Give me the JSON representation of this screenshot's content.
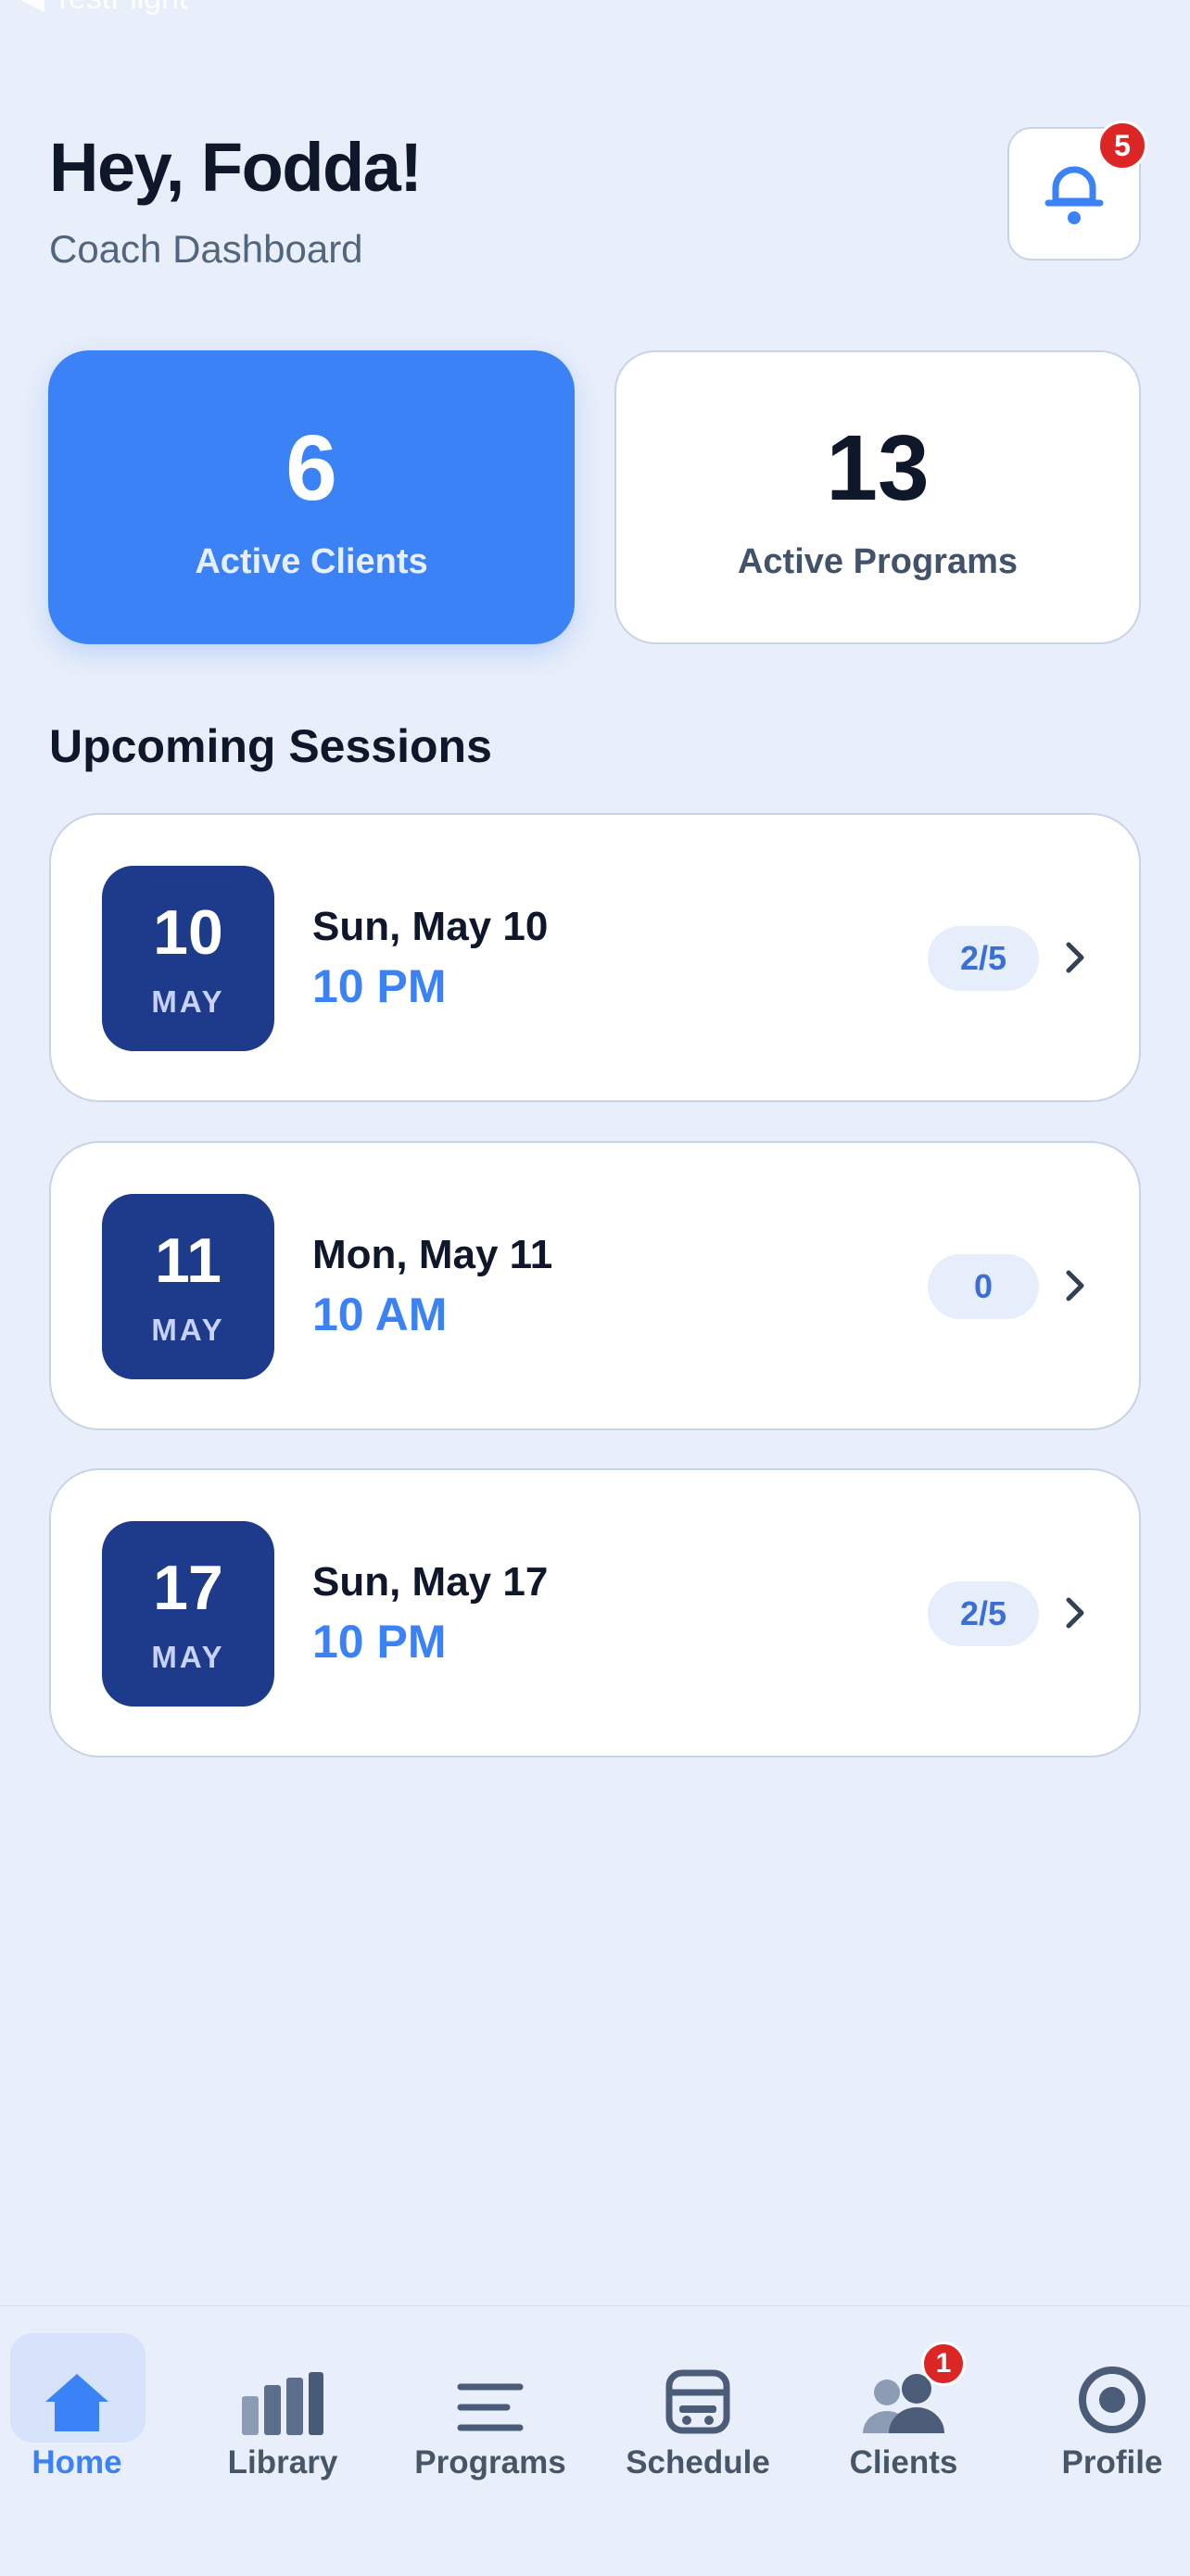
{
  "status_bar": {
    "back_label": "◀ TestFlight"
  },
  "header": {
    "greeting": "Hey, Fodda!",
    "subtitle": "Coach Dashboard",
    "notification_count": "5"
  },
  "stats": [
    {
      "value": "6",
      "label": "Active Clients"
    },
    {
      "value": "13",
      "label": "Active Programs"
    }
  ],
  "sessions_title": "Upcoming Sessions",
  "sessions": [
    {
      "day": "10",
      "month": "MAY",
      "date": "Sun, May 10",
      "time": "10 PM",
      "count": "2/5"
    },
    {
      "day": "11",
      "month": "MAY",
      "date": "Mon, May 11",
      "time": "10 AM",
      "count": "0"
    },
    {
      "day": "17",
      "month": "MAY",
      "date": "Sun, May 17",
      "time": "10 PM",
      "count": "2/5"
    }
  ],
  "tabs": [
    {
      "label": "Home",
      "icon": "home-icon",
      "active": true
    },
    {
      "label": "Library",
      "icon": "library-icon"
    },
    {
      "label": "Programs",
      "icon": "programs-icon"
    },
    {
      "label": "Schedule",
      "icon": "schedule-icon"
    },
    {
      "label": "Clients",
      "icon": "clients-icon",
      "badge": "1"
    },
    {
      "label": "Profile",
      "icon": "profile-icon"
    }
  ],
  "colors": {
    "accent": "#3B82F6",
    "date_box": "#1E3A8A",
    "badge": "#DC2626",
    "background": "#E9EFFA"
  }
}
